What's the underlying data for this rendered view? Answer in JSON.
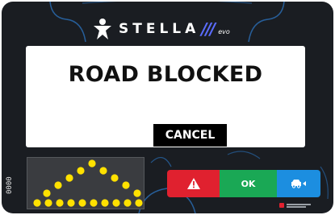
{
  "brand": {
    "name": "STELLA",
    "slashes": "///",
    "suffix": "evo",
    "logo_icon": "person-star-icon"
  },
  "dialog": {
    "title": "ROAD BLOCKED",
    "cancel_label": "CANCEL"
  },
  "side_label": "0000",
  "arrow_board": {
    "pattern": "chevron-warning",
    "light_color": "#ffe100",
    "background": "#3a3c40"
  },
  "controls": [
    {
      "name": "hazard",
      "icon": "warning-triangle-icon",
      "label": "",
      "color": "#e0212f"
    },
    {
      "name": "ok",
      "icon": "",
      "label": "OK",
      "color": "#1aa855"
    },
    {
      "name": "lane",
      "icon": "vehicle-lane-icon",
      "label": "",
      "color": "#1c8ee0"
    }
  ],
  "colors": {
    "device_bg": "#1a1d22",
    "accent_blue": "#5b6cff",
    "deco_lines": "#2a6fb8"
  }
}
